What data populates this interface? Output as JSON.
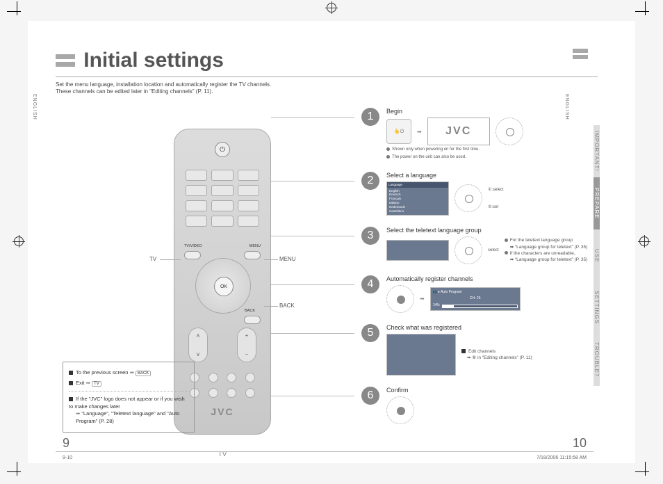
{
  "title": "Initial settings",
  "intro": "Set the menu language, installation location and automatically register the TV channels.\nThese channels can be edited later in \"Editing channels\" (P. 11).",
  "sideLabel": "ENGLISH",
  "tabs": {
    "important": "IMPORTANT!",
    "prepare": "PREPARE",
    "use": "USE",
    "settings": "SETTINGS",
    "trouble": "TROUBLE?"
  },
  "remote": {
    "tvvideo": "TV/VIDEO",
    "menu": "MENU",
    "back": "BACK",
    "ok": "OK",
    "logo": "JVC",
    "caption": "TV",
    "leads": {
      "tv": "TV",
      "menu": "MENU",
      "back": "BACK"
    },
    "power": "⏻"
  },
  "infobox": {
    "line1": "To the previous screen",
    "line1_btn": "BACK",
    "line2": "Exit",
    "line2_btn": "TV",
    "line3": "If the \"JVC\" logo does not appear or if you wish to make changes later",
    "line3_ref": "“Language”, “Teletext language” and “Auto Program” (P. 28)"
  },
  "steps": {
    "s1": {
      "title": "Begin",
      "note1": "Shown only when powering on for the first time.",
      "note2": "The power on the unit can also be used.",
      "logo": "JVC"
    },
    "s2": {
      "title": "Select a language",
      "osdTitle": "Language",
      "options": [
        "English",
        "Deutsch",
        "Français",
        "Italiano",
        "Nederlands",
        "Castellano"
      ],
      "annoSelect": "①:select",
      "annoSet": "②:set"
    },
    "s3": {
      "title": "Select the teletext language group",
      "annoSelect": "select",
      "notesTitle1": "For the teletext language group",
      "notesRef1": "“Language group for teletext” (P. 35)",
      "notesTitle2": "If the characters are unreadable,",
      "notesRef2": "“Language group for teletext” (P. 35)"
    },
    "s4": {
      "title": "Automatically register channels",
      "progTitle": "Auto Program",
      "progCh": "CH: 26",
      "progPct": "14%"
    },
    "s5": {
      "title": "Check what was registered",
      "editTitle": "Edit channels",
      "editRef": "⑧ in “Editing channels” (P. 11)"
    },
    "s6": {
      "title": "Confirm"
    }
  },
  "page": {
    "left": "9",
    "right": "10"
  },
  "footer": {
    "left": "9-10",
    "right": "7/18/2006   11:15:58 AM"
  }
}
